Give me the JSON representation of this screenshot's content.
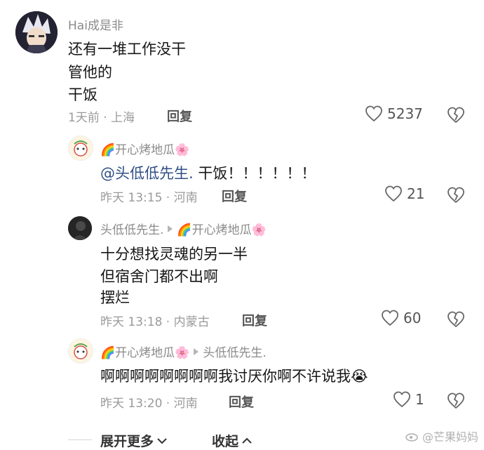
{
  "comments": [
    {
      "username": "Hai成是非",
      "lines": [
        "还有一堆工作没干",
        "管他的",
        "干饭"
      ],
      "time": "1天前 · 上海",
      "reply_label": "回复",
      "likes": "5237"
    },
    {
      "username": "🌈开心烤地瓜🌸",
      "mention": "@头低低先生.",
      "text": " 干饭！！！！！！",
      "time": "昨天 13:15 · 河南",
      "reply_label": "回复",
      "likes": "21"
    },
    {
      "username": "头低低先生.",
      "reply_to": "🌈开心烤地瓜🌸",
      "lines": [
        "十分想找灵魂的另一半",
        "但宿舍门都不出啊",
        "摆烂"
      ],
      "time": "昨天 13:18 · 内蒙古",
      "reply_label": "回复",
      "likes": "60"
    },
    {
      "username": "🌈开心烤地瓜🌸",
      "reply_to": "头低低先生.",
      "text": "啊啊啊啊啊啊啊啊我讨厌你啊不许说我😭",
      "time": "昨天 13:20 · 河南",
      "reply_label": "回复",
      "likes": "1"
    }
  ],
  "footer": {
    "expand_label": "展开更多",
    "collapse_label": "收起"
  },
  "watermark": "@芒果妈妈",
  "colors": {
    "mention": "#2f4f86",
    "meta": "#9a9a9a",
    "username": "#8a8a8a"
  }
}
